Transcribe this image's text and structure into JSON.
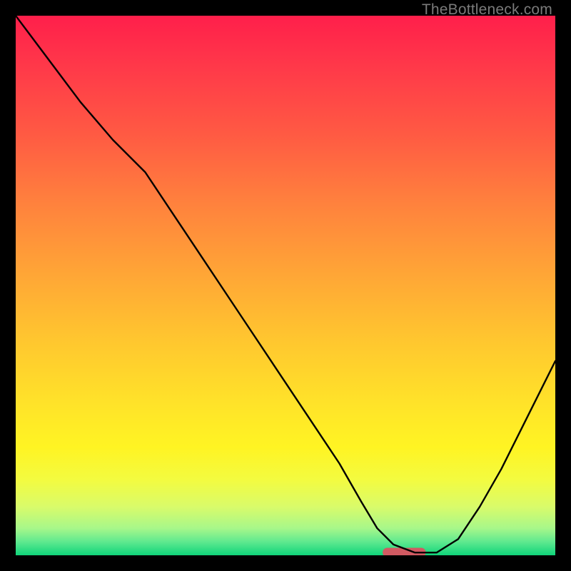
{
  "watermark": "TheBottleneck.com",
  "chart_data": {
    "type": "line",
    "title": "",
    "xlabel": "",
    "ylabel": "",
    "xlim": [
      0,
      100
    ],
    "ylim": [
      0,
      100
    ],
    "grid": false,
    "legend": false,
    "series": [
      {
        "name": "curve",
        "x": [
          0,
          6,
          12,
          18,
          24,
          30,
          36,
          42,
          48,
          54,
          60,
          64,
          67,
          70,
          74,
          78,
          82,
          86,
          90,
          94,
          100
        ],
        "y": [
          100,
          92,
          84,
          77,
          71,
          62,
          53,
          44,
          35,
          26,
          17,
          10,
          5,
          2,
          0.5,
          0.5,
          3,
          9,
          16,
          24,
          36
        ]
      }
    ],
    "optimal_marker": {
      "x_start": 68,
      "x_end": 76,
      "y": 0.6
    },
    "gradient_stops": [
      {
        "offset": 0.0,
        "color": "#ff1f4b"
      },
      {
        "offset": 0.1,
        "color": "#ff3a49"
      },
      {
        "offset": 0.22,
        "color": "#ff5a43"
      },
      {
        "offset": 0.35,
        "color": "#ff823d"
      },
      {
        "offset": 0.48,
        "color": "#ffa636"
      },
      {
        "offset": 0.6,
        "color": "#ffc62f"
      },
      {
        "offset": 0.72,
        "color": "#ffe329"
      },
      {
        "offset": 0.8,
        "color": "#fff423"
      },
      {
        "offset": 0.86,
        "color": "#f3fb40"
      },
      {
        "offset": 0.91,
        "color": "#d9fb6a"
      },
      {
        "offset": 0.95,
        "color": "#a7f78a"
      },
      {
        "offset": 0.975,
        "color": "#5fe98f"
      },
      {
        "offset": 1.0,
        "color": "#0fd47a"
      }
    ],
    "marker_color": "#d15a62",
    "curve_color": "#000000"
  }
}
